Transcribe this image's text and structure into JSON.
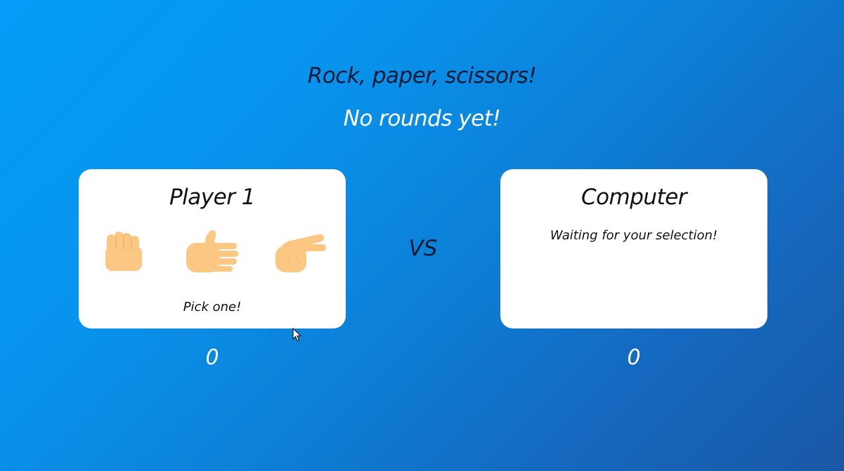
{
  "header": {
    "title": "Rock, paper, scissors!",
    "round_status": "No rounds yet!"
  },
  "player": {
    "name": "Player 1",
    "choices": [
      {
        "id": "rock",
        "icon": "rock-fist-icon"
      },
      {
        "id": "paper",
        "icon": "paper-hand-icon"
      },
      {
        "id": "scissors",
        "icon": "scissors-hand-icon"
      }
    ],
    "prompt": "Pick one!",
    "score": "0"
  },
  "versus": "VS",
  "computer": {
    "name": "Computer",
    "status": "Waiting for your selection!",
    "score": "0"
  },
  "colors": {
    "background_start": "#039cf6",
    "background_end": "#1a58a6",
    "card": "#ffffff",
    "skin": "#fcc783"
  }
}
